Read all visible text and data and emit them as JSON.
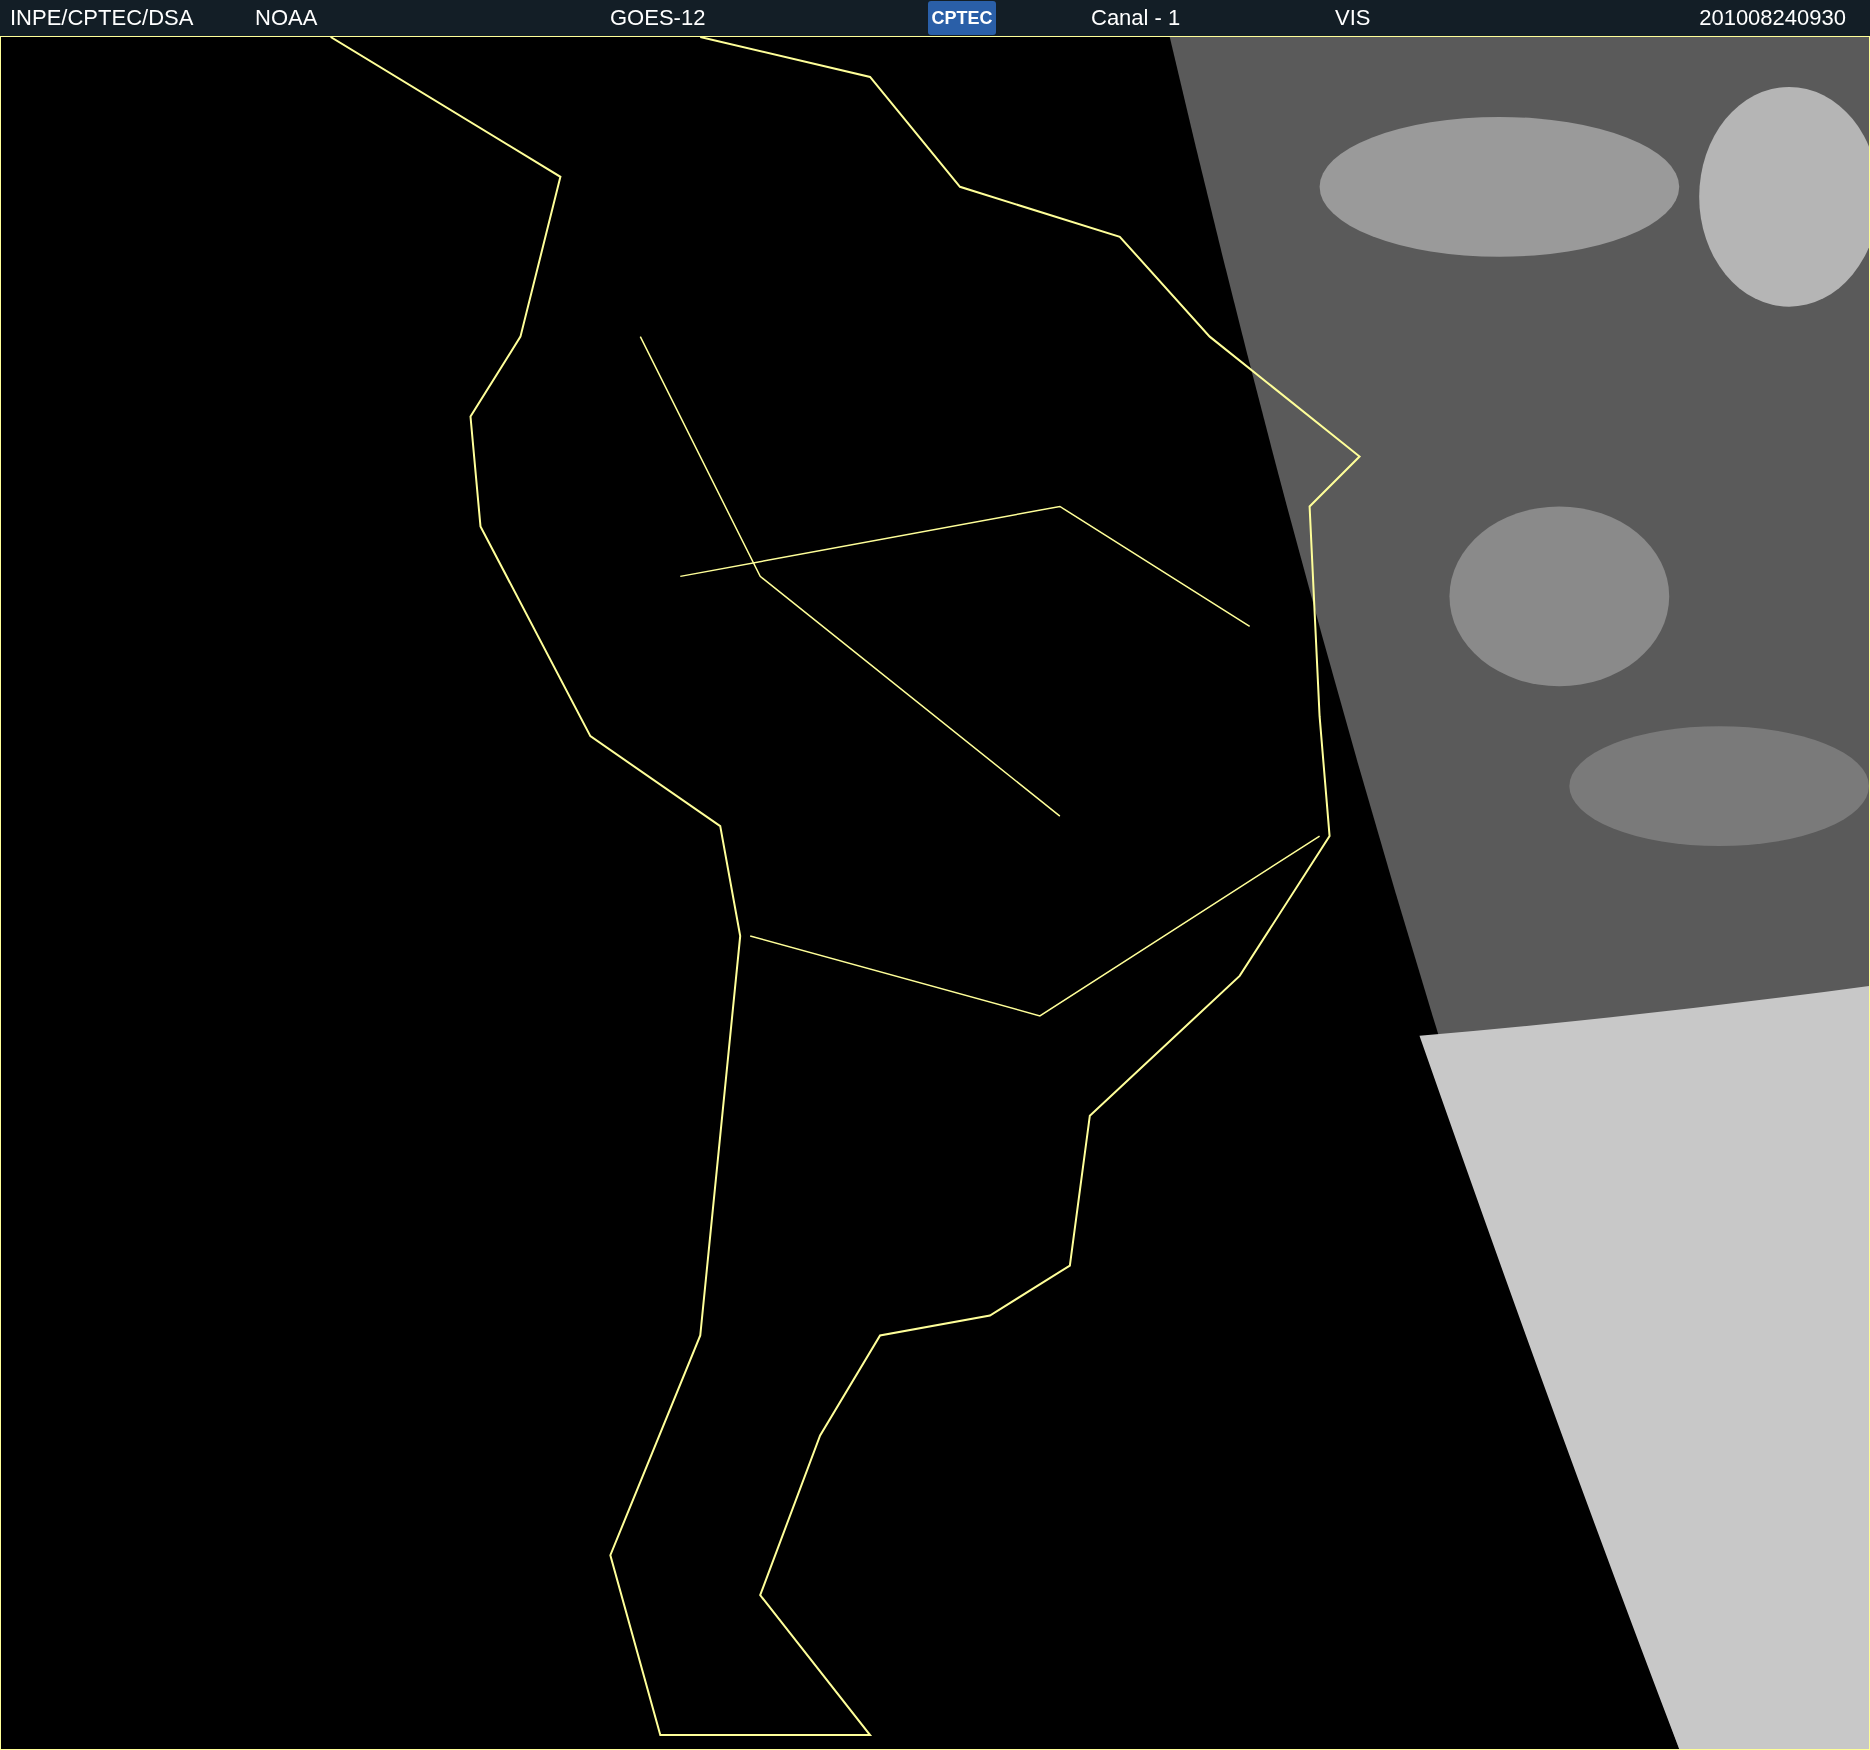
{
  "header": {
    "source": "INPE/CPTEC/DSA",
    "agency": "NOAA",
    "satellite": "GOES-12",
    "logo": "CPTEC",
    "channel": "Canal - 1",
    "band": "VIS",
    "timestamp": "201008240930"
  }
}
